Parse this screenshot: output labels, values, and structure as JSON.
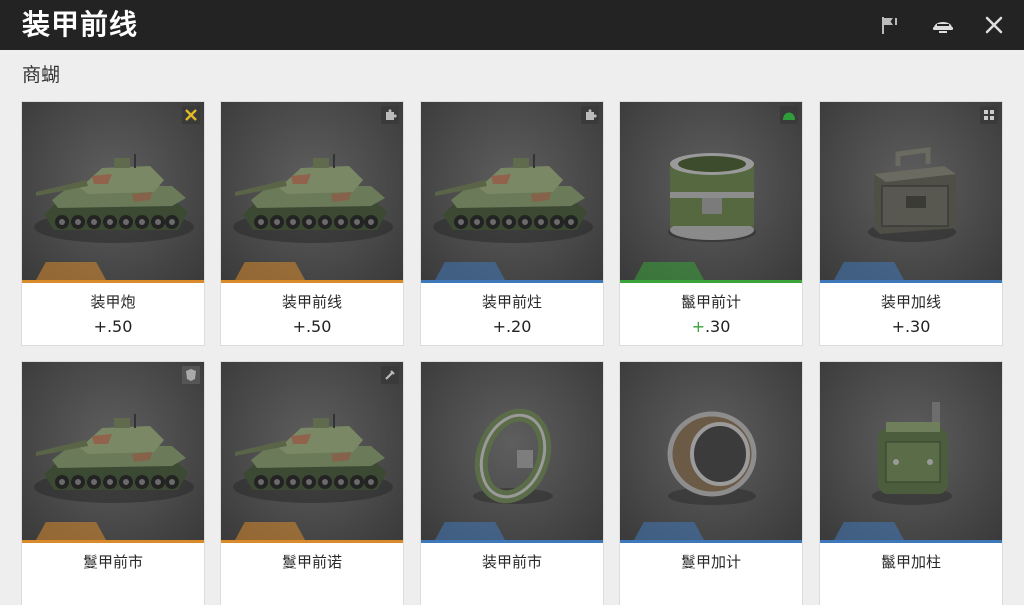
{
  "app": {
    "title": "装甲前线",
    "section": "商蝴",
    "icons": [
      "flag-icon",
      "helmet-icon",
      "close-icon"
    ]
  },
  "cards": [
    {
      "name": "装甲炮",
      "sign": "+",
      "number": ".50",
      "item": "tank",
      "rarity": "orange",
      "badge": "crossed-swords-icon"
    },
    {
      "name": "装甲前线",
      "sign": "+",
      "number": ".50",
      "item": "tank",
      "rarity": "orange",
      "badge": "puzzle-icon"
    },
    {
      "name": "装甲前炷",
      "sign": "+",
      "number": ".20",
      "item": "tank",
      "rarity": "blue",
      "badge": "puzzle-icon"
    },
    {
      "name": "鬣甲前计",
      "sign": "+",
      "number": ".30",
      "item": "drum",
      "rarity": "green",
      "badge": "helmet-badge-icon",
      "sign_green": true
    },
    {
      "name": "装甲加线",
      "sign": "+",
      "number": ".30",
      "item": "crate",
      "rarity": "blue",
      "badge": "grid-icon"
    },
    {
      "name": "鬘甲前市",
      "sign": "",
      "number": "",
      "item": "tank",
      "rarity": "orange",
      "badge": "shield-icon"
    },
    {
      "name": "鬘甲前诺",
      "sign": "",
      "number": "",
      "item": "tank",
      "rarity": "orange",
      "badge": "wrench-icon"
    },
    {
      "name": "装甲前市",
      "sign": "",
      "number": "",
      "item": "ring",
      "rarity": "blue",
      "badge": ""
    },
    {
      "name": "鬘甲加计",
      "sign": "",
      "number": "",
      "item": "band",
      "rarity": "blue",
      "badge": ""
    },
    {
      "name": "鬣甲加柱",
      "sign": "",
      "number": "",
      "item": "backpack",
      "rarity": "blue",
      "badge": ""
    }
  ],
  "colors": {
    "orange": "#d98a2b",
    "blue": "#3f78b8",
    "green": "#3aa33a",
    "topbar": "#232323",
    "badge_yellow": "#e3b928",
    "badge_green": "#2f9e3a"
  }
}
